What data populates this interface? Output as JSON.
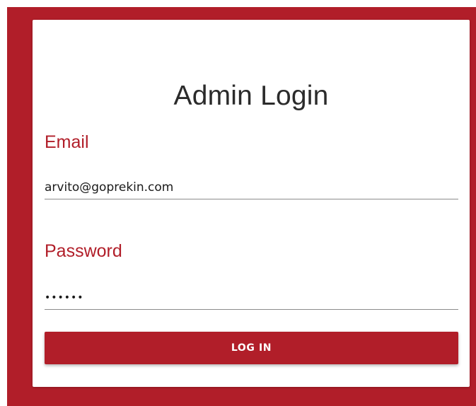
{
  "login": {
    "title": "Admin Login",
    "email_label": "Email",
    "email_value": "arvito@goprekin.com",
    "password_label": "Password",
    "password_value": "aaaaaa",
    "submit_label": "LOG IN"
  },
  "colors": {
    "brand": "#b11e29",
    "card": "#ffffff",
    "text": "#2b2b2b"
  }
}
